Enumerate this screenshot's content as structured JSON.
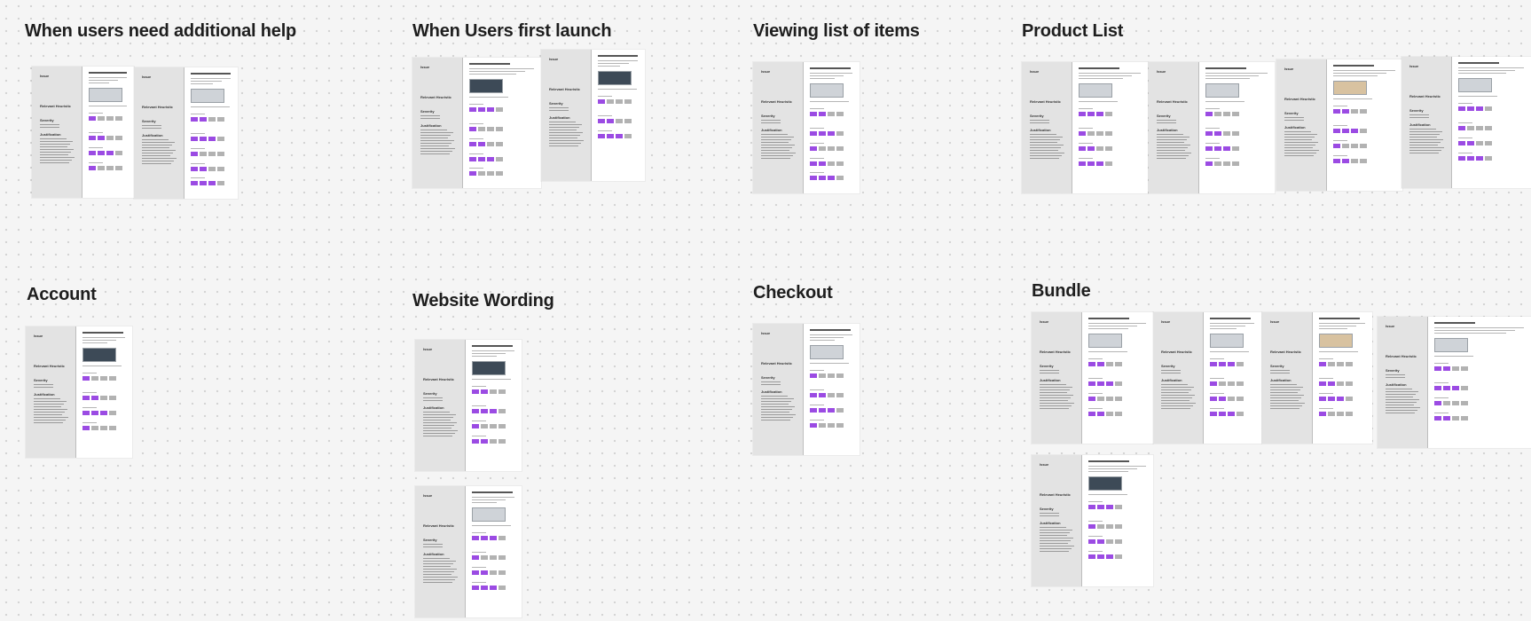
{
  "sections": [
    {
      "title": "When users need additional help"
    },
    {
      "title": "When Users first launch"
    },
    {
      "title": "Viewing list of items"
    },
    {
      "title": "Product List"
    },
    {
      "title": "Account"
    },
    {
      "title": "Website Wording"
    },
    {
      "title": "Checkout"
    },
    {
      "title": "Bundle"
    }
  ],
  "card_labels": {
    "issue": "Issue",
    "relevant_heuristic": "Relevant Heuristic",
    "severity": "Severity",
    "justification": "Justification"
  },
  "colors": {
    "accent": "#9b4be3",
    "box_inactive": "#b2b2b2",
    "sidebar": "#e3e3e3",
    "canvas": "#f5f5f5"
  }
}
